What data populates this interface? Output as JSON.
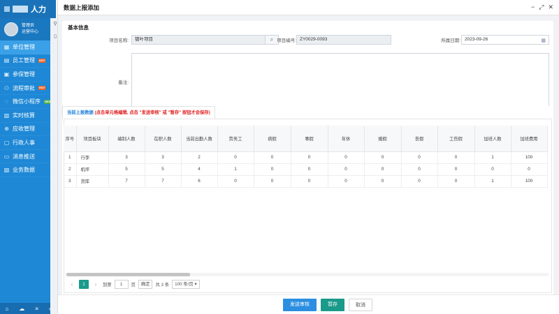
{
  "sidebar": {
    "brand": "人力",
    "user_name": "管理员",
    "user_role": "运营中心",
    "items": [
      {
        "label": "单位管理",
        "icon": "building-icon",
        "active": true,
        "badge": ""
      },
      {
        "label": "员工管理",
        "icon": "users-icon",
        "active": false,
        "badge": "HOT"
      },
      {
        "label": "参保管理",
        "icon": "shield-icon",
        "active": false,
        "badge": ""
      },
      {
        "label": "流程审批",
        "icon": "approve-icon",
        "active": false,
        "badge": "HOT"
      },
      {
        "label": "微信小程序",
        "icon": "wechat-icon",
        "active": false,
        "badge": "NEW"
      },
      {
        "label": "实时核算",
        "icon": "calculator-icon",
        "active": false,
        "badge": ""
      },
      {
        "label": "应收管理",
        "icon": "receivable-icon",
        "active": false,
        "badge": ""
      },
      {
        "label": "行政人事",
        "icon": "admin-icon",
        "active": false,
        "badge": ""
      },
      {
        "label": "消息推送",
        "icon": "message-icon",
        "active": false,
        "badge": ""
      },
      {
        "label": "业务数据",
        "icon": "data-icon",
        "active": false,
        "badge": ""
      }
    ],
    "bottom_icons": [
      "home-icon",
      "cloud-icon",
      "menu-icon",
      "collapse-icon"
    ]
  },
  "dialog": {
    "title": "数据上报添加",
    "controls": [
      "minimize-icon",
      "maximize-icon",
      "close-icon"
    ]
  },
  "basic_info": {
    "section_title": "基本信息",
    "project_name_label": "项目名称:",
    "project_name_value": "镀叶项目",
    "project_code_label": "项目编号:",
    "project_code_value": "ZY0029-0093",
    "date_label": "所属日期:",
    "date_value": "2023-09-26",
    "remark_label": "备注:",
    "remark_value": ""
  },
  "data_tab": {
    "title": "当前上报数据",
    "hint": "(点击单元格编辑, 点击 \"发送审核\" 或 \"暂存\" 按钮才会保存)"
  },
  "table": {
    "columns": [
      "序号",
      "项目板块",
      "编制人数",
      "在职人数",
      "当前出勤人数",
      "劳务工",
      "病假",
      "事假",
      "年休",
      "婚假",
      "丧假",
      "工伤假",
      "加班人数",
      "加班费用"
    ],
    "rows": [
      [
        "1",
        "行李",
        "3",
        "3",
        "2",
        "0",
        "0",
        "0",
        "0",
        "0",
        "0",
        "0",
        "1",
        "100"
      ],
      [
        "2",
        "机坪",
        "5",
        "5",
        "4",
        "1",
        "0",
        "0",
        "0",
        "0",
        "0",
        "0",
        "0",
        "0"
      ],
      [
        "3",
        "货库",
        "7",
        "7",
        "6",
        "0",
        "0",
        "0",
        "0",
        "0",
        "0",
        "0",
        "1",
        "100"
      ]
    ]
  },
  "pager": {
    "current_page": "1",
    "goto_label": "到第",
    "goto_value": "1",
    "page_unit": "页",
    "confirm_label": "确定",
    "total_label": "共 3 条",
    "page_size": "100 条/页"
  },
  "footer": {
    "send_label": "发送审核",
    "save_label": "暂存",
    "cancel_label": "取消"
  },
  "colors": {
    "sidebar": "#1e88d6",
    "primary": "#2b8ee0",
    "teal": "#1a9a8a",
    "hint_red": "#e02020"
  }
}
